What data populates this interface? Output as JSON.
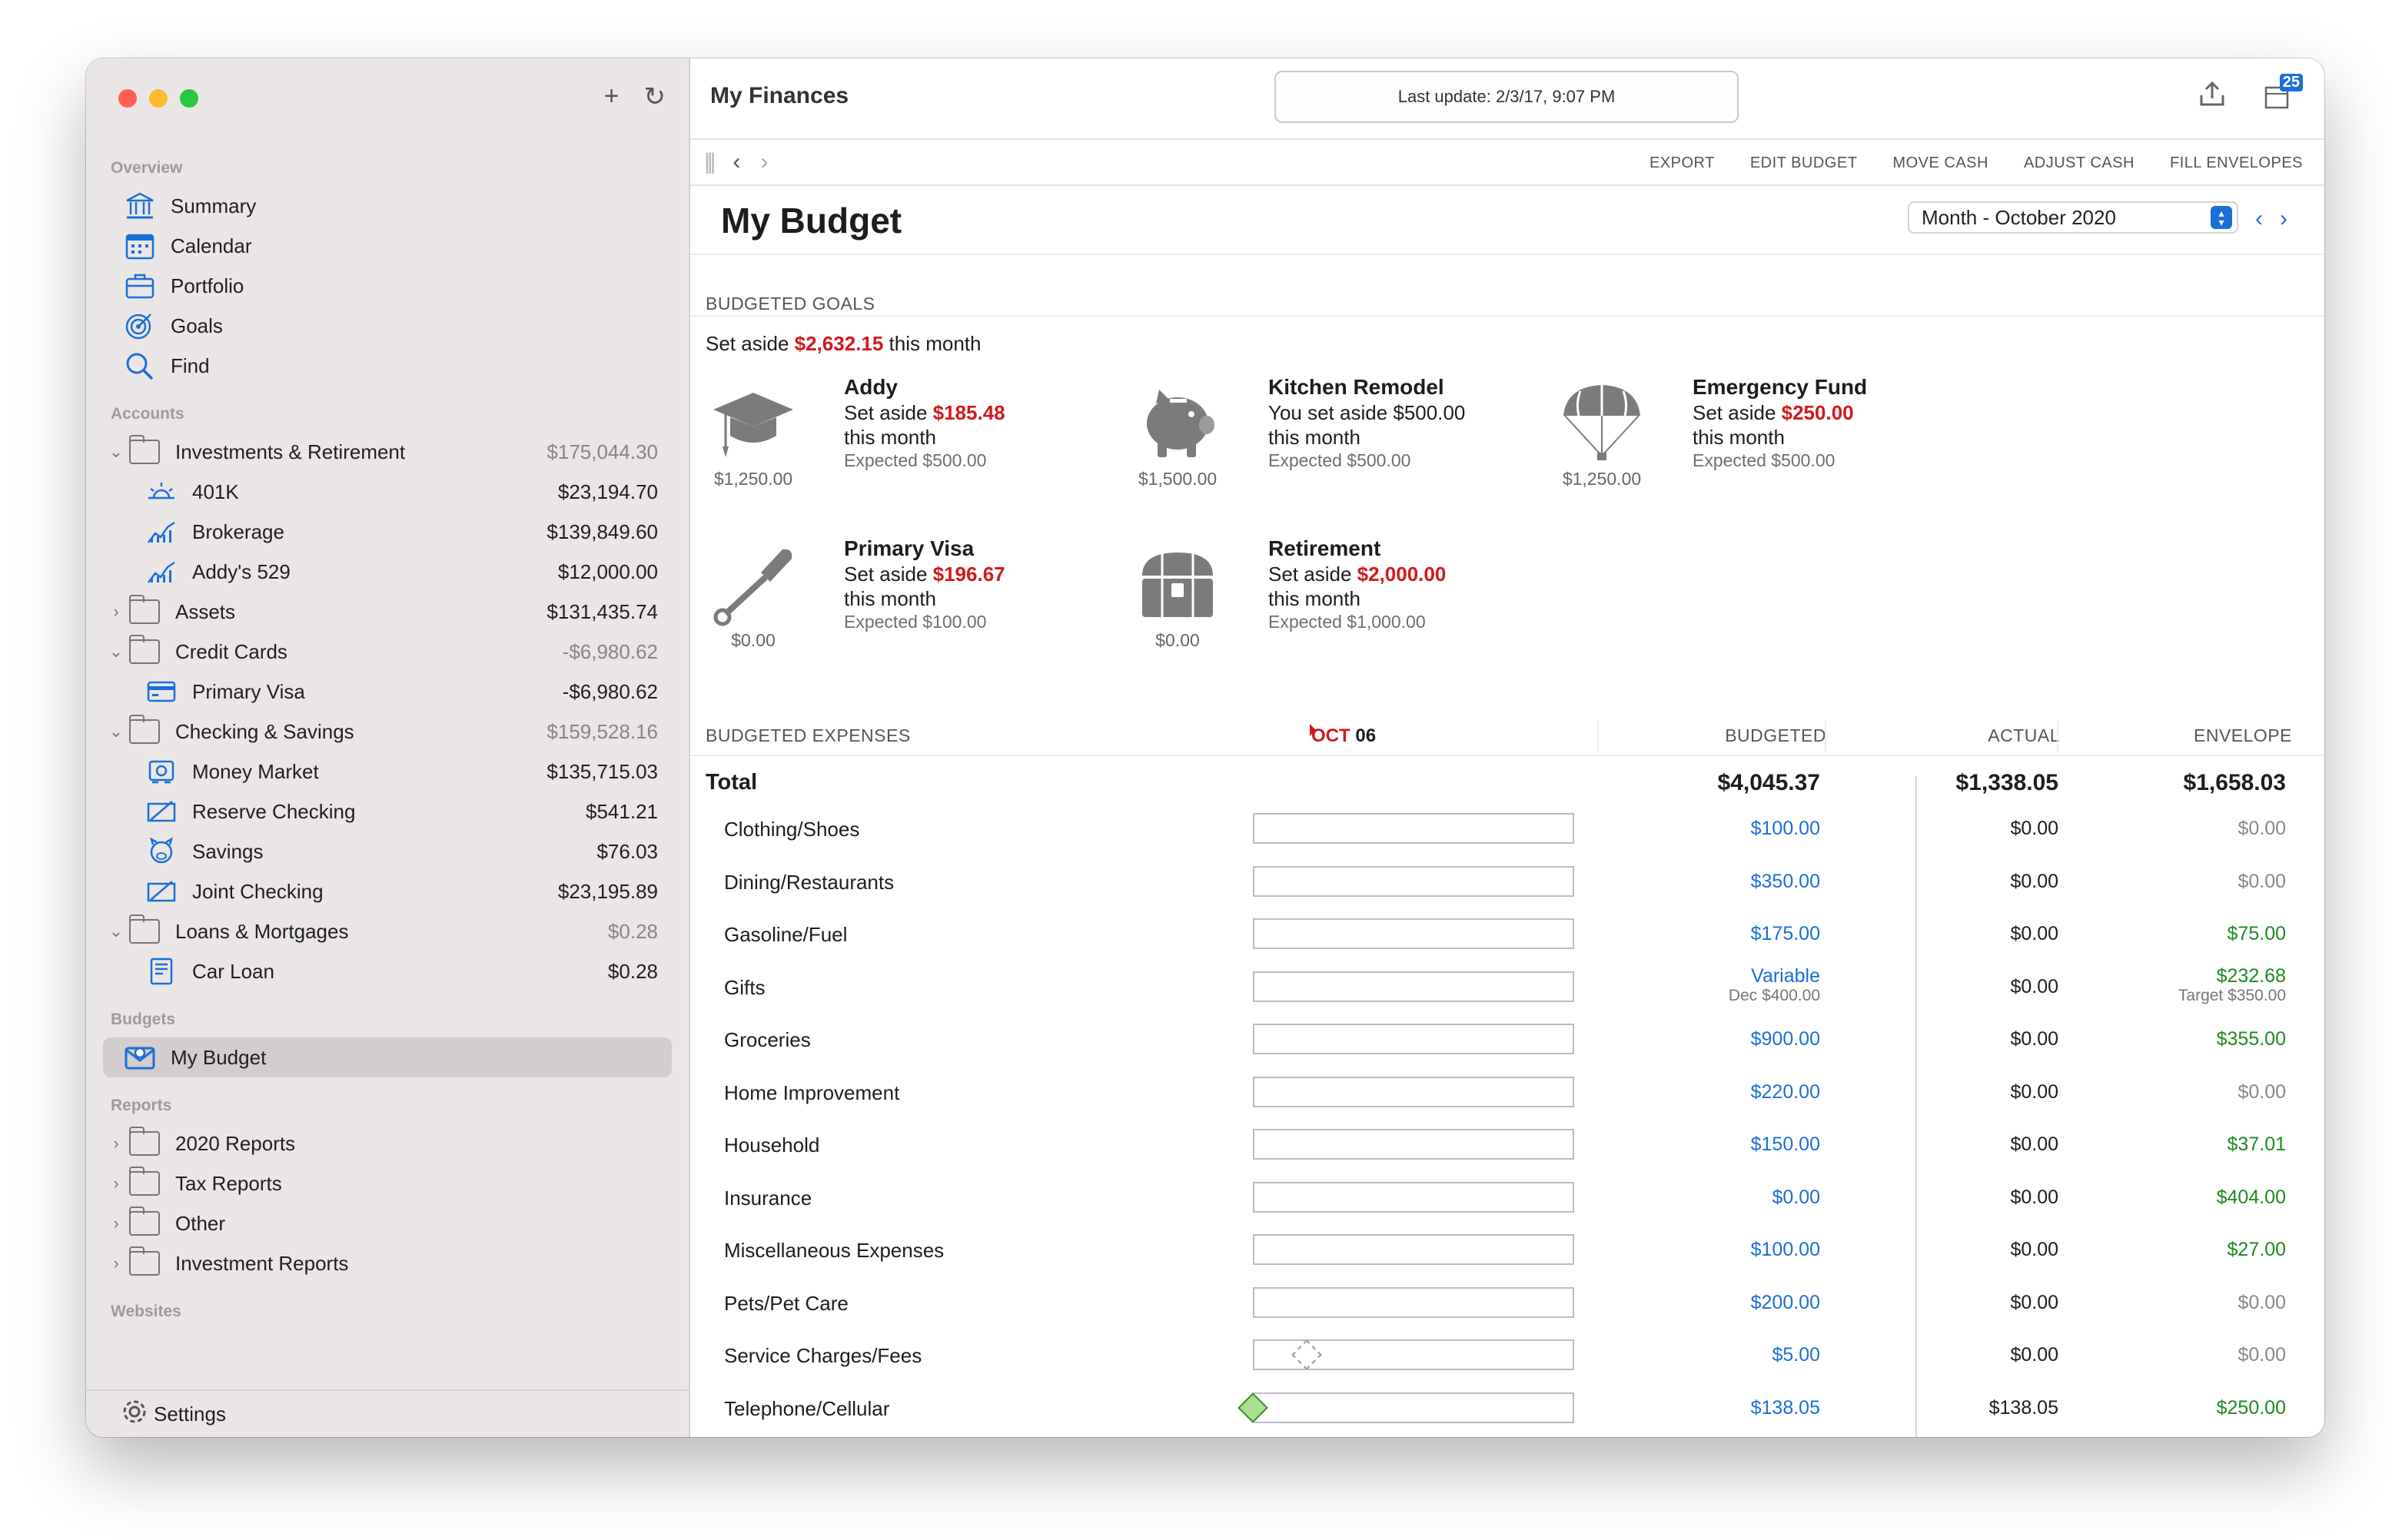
{
  "sidebar": {
    "tools": {
      "add": "+",
      "refresh": "↻"
    },
    "overview": {
      "heading": "Overview",
      "items": [
        {
          "label": "Summary",
          "icon": "bank-icon"
        },
        {
          "label": "Calendar",
          "icon": "calendar-icon"
        },
        {
          "label": "Portfolio",
          "icon": "briefcase-icon"
        },
        {
          "label": "Goals",
          "icon": "target-icon"
        },
        {
          "label": "Find",
          "icon": "search-icon"
        }
      ]
    },
    "accounts": {
      "heading": "Accounts",
      "groups": [
        {
          "label": "Investments & Retirement",
          "amount": "$175,044.30",
          "expanded": true,
          "children": [
            {
              "label": "401K",
              "amount": "$23,194.70"
            },
            {
              "label": "Brokerage",
              "amount": "$139,849.60"
            },
            {
              "label": "Addy's 529",
              "amount": "$12,000.00"
            }
          ]
        },
        {
          "label": "Assets",
          "amount": "$131,435.74",
          "expanded": false,
          "children": []
        },
        {
          "label": "Credit Cards",
          "amount": "-$6,980.62",
          "expanded": true,
          "children": [
            {
              "label": "Primary Visa",
              "amount": "-$6,980.62"
            }
          ]
        },
        {
          "label": "Checking & Savings",
          "amount": "$159,528.16",
          "expanded": true,
          "children": [
            {
              "label": "Money Market",
              "amount": "$135,715.03"
            },
            {
              "label": "Reserve Checking",
              "amount": "$541.21"
            },
            {
              "label": "Savings",
              "amount": "$76.03"
            },
            {
              "label": "Joint Checking",
              "amount": "$23,195.89"
            }
          ]
        },
        {
          "label": "Loans & Mortgages",
          "amount": "$0.28",
          "expanded": true,
          "children": [
            {
              "label": "Car Loan",
              "amount": "$0.28"
            }
          ]
        }
      ]
    },
    "budgets": {
      "heading": "Budgets",
      "items": [
        {
          "label": "My Budget"
        }
      ]
    },
    "reports": {
      "heading": "Reports",
      "items": [
        {
          "label": "2020 Reports"
        },
        {
          "label": "Tax Reports"
        },
        {
          "label": "Other"
        },
        {
          "label": "Investment Reports"
        }
      ]
    },
    "websites": {
      "heading": "Websites"
    },
    "settings_label": "Settings"
  },
  "titlebar": {
    "app_title": "My Finances",
    "last_update": "Last update: 2/3/17, 9:07 PM",
    "badge_count": "25"
  },
  "toolbar": {
    "actions": [
      "EXPORT",
      "EDIT BUDGET",
      "MOVE CASH",
      "ADJUST CASH",
      "FILL ENVELOPES"
    ]
  },
  "page": {
    "title": "My Budget",
    "period": "Month - October 2020"
  },
  "goals": {
    "heading": "BUDGETED GOALS",
    "set_aside_prefix": "Set aside",
    "set_aside_amount": "$2,632.15",
    "set_aside_suffix": "this month",
    "items": [
      {
        "name": "Addy",
        "prefix": "Set aside",
        "amount": "$185.48",
        "line2": "this month",
        "expected": "Expected $500.00",
        "balance": "$1,250.00",
        "icon": "graduation-cap-icon"
      },
      {
        "name": "Kitchen Remodel",
        "prefix": "You set aside $500.00",
        "amount": "",
        "line2": "this month",
        "expected": "Expected $500.00",
        "balance": "$1,500.00",
        "icon": "piggy-bank-icon"
      },
      {
        "name": "Emergency Fund",
        "prefix": "Set aside",
        "amount": "$250.00",
        "line2": "this month",
        "expected": "Expected $500.00",
        "balance": "$1,250.00",
        "icon": "parachute-icon"
      },
      {
        "name": "Primary Visa",
        "prefix": "Set aside",
        "amount": "$196.67",
        "line2": "this month",
        "expected": "Expected $100.00",
        "balance": "$0.00",
        "icon": "shovel-icon"
      },
      {
        "name": "Retirement",
        "prefix": "Set aside",
        "amount": "$2,000.00",
        "line2": "this month",
        "expected": "Expected $1,000.00",
        "balance": "$0.00",
        "icon": "treasure-chest-icon"
      }
    ]
  },
  "expenses": {
    "heading": "BUDGETED EXPENSES",
    "today_month": "OCT",
    "today_day": "06",
    "columns": {
      "budgeted": "BUDGETED",
      "actual": "ACTUAL",
      "envelope": "ENVELOPE"
    },
    "total": {
      "label": "Total",
      "budgeted": "$4,045.37",
      "actual": "$1,338.05",
      "envelope": "$1,658.03"
    },
    "rows": [
      {
        "name": "Clothing/Shoes",
        "budgeted": "$100.00",
        "budgeted_sub": "",
        "actual": "$0.00",
        "envelope": "$0.00",
        "envelope_sub": "",
        "envelope_color": "grey",
        "marker": ""
      },
      {
        "name": "Dining/Restaurants",
        "budgeted": "$350.00",
        "budgeted_sub": "",
        "actual": "$0.00",
        "envelope": "$0.00",
        "envelope_sub": "",
        "envelope_color": "grey",
        "marker": ""
      },
      {
        "name": "Gasoline/Fuel",
        "budgeted": "$175.00",
        "budgeted_sub": "",
        "actual": "$0.00",
        "envelope": "$75.00",
        "envelope_sub": "",
        "envelope_color": "green",
        "marker": ""
      },
      {
        "name": "Gifts",
        "budgeted": "Variable",
        "budgeted_sub": "Dec $400.00",
        "actual": "$0.00",
        "envelope": "$232.68",
        "envelope_sub": "Target $350.00",
        "envelope_color": "green",
        "marker": ""
      },
      {
        "name": "Groceries",
        "budgeted": "$900.00",
        "budgeted_sub": "",
        "actual": "$0.00",
        "envelope": "$355.00",
        "envelope_sub": "",
        "envelope_color": "green",
        "marker": ""
      },
      {
        "name": "Home Improvement",
        "budgeted": "$220.00",
        "budgeted_sub": "",
        "actual": "$0.00",
        "envelope": "$0.00",
        "envelope_sub": "",
        "envelope_color": "grey",
        "marker": ""
      },
      {
        "name": "Household",
        "budgeted": "$150.00",
        "budgeted_sub": "",
        "actual": "$0.00",
        "envelope": "$37.01",
        "envelope_sub": "",
        "envelope_color": "green",
        "marker": ""
      },
      {
        "name": "Insurance",
        "budgeted": "$0.00",
        "budgeted_sub": "",
        "actual": "$0.00",
        "envelope": "$404.00",
        "envelope_sub": "",
        "envelope_color": "green",
        "marker": ""
      },
      {
        "name": "Miscellaneous Expenses",
        "budgeted": "$100.00",
        "budgeted_sub": "",
        "actual": "$0.00",
        "envelope": "$27.00",
        "envelope_sub": "",
        "envelope_color": "green",
        "marker": ""
      },
      {
        "name": "Pets/Pet Care",
        "budgeted": "$200.00",
        "budgeted_sub": "",
        "actual": "$0.00",
        "envelope": "$0.00",
        "envelope_sub": "",
        "envelope_color": "grey",
        "marker": ""
      },
      {
        "name": "Service Charges/Fees",
        "budgeted": "$5.00",
        "budgeted_sub": "",
        "actual": "$0.00",
        "envelope": "$0.00",
        "envelope_sub": "",
        "envelope_color": "grey",
        "marker": "dashed"
      },
      {
        "name": "Telephone/Cellular",
        "budgeted": "$138.05",
        "budgeted_sub": "",
        "actual": "$138.05",
        "envelope": "$250.00",
        "envelope_sub": "",
        "envelope_color": "green",
        "marker": "green"
      }
    ]
  },
  "colors": {
    "accent": "#1a6fd8",
    "negative": "#d01a1a",
    "positive": "#1e8a22",
    "sidebar_bg": "#ebe6e6"
  }
}
